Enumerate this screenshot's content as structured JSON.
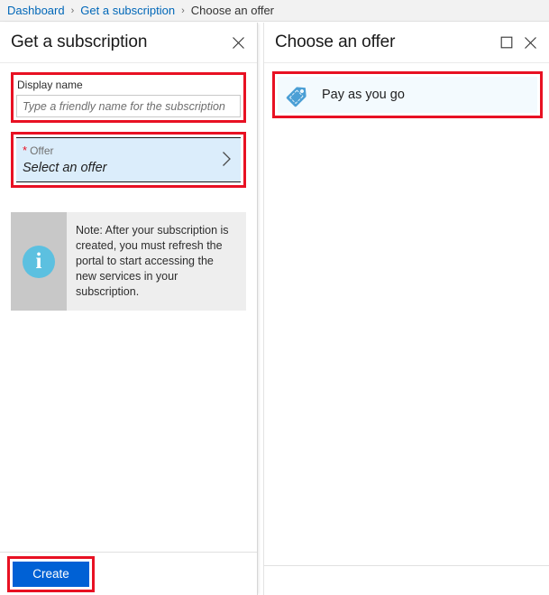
{
  "breadcrumb": {
    "items": [
      {
        "label": "Dashboard",
        "type": "link"
      },
      {
        "label": "Get a subscription",
        "type": "link"
      },
      {
        "label": "Choose an offer",
        "type": "current"
      }
    ],
    "separator": "›"
  },
  "left_blade": {
    "title": "Get a subscription",
    "close_label": "✕",
    "display_name": {
      "label": "Display name",
      "value": "",
      "placeholder": "Type a friendly name for the subscription"
    },
    "offer": {
      "required_marker": "*",
      "label": "Offer",
      "value": "Select an offer",
      "chevron": "›"
    },
    "note": {
      "icon": "info-icon",
      "icon_glyph": "i",
      "text": "Note: After your subscription is created, you must refresh the portal to start accessing the new services in your subscription."
    },
    "footer": {
      "create_label": "Create"
    }
  },
  "right_blade": {
    "title": "Choose an offer",
    "maximize_label": "□",
    "close_label": "✕",
    "offers": [
      {
        "label": "Pay as you go",
        "icon": "price-tag-icon"
      }
    ]
  },
  "colors": {
    "link": "#0067b8",
    "highlight_red": "#e81123",
    "primary_button": "#0061d5",
    "selected_row": "#dbedfb",
    "tag_icon": "#4b9fd5",
    "info_icon": "#5cc0e0"
  }
}
